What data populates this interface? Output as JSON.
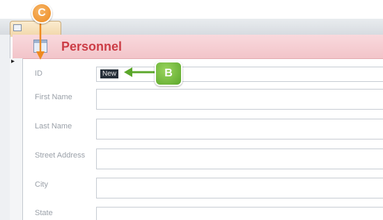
{
  "tab": {
    "label": ""
  },
  "form": {
    "title": "Personnel",
    "record_selector": "▸",
    "fields": [
      {
        "label": "ID",
        "value": "New"
      },
      {
        "label": "First Name",
        "value": ""
      },
      {
        "label": "Last Name",
        "value": ""
      },
      {
        "label": "Street Address",
        "value": ""
      },
      {
        "label": "City",
        "value": ""
      },
      {
        "label": "State",
        "value": ""
      }
    ]
  },
  "callouts": {
    "c": "C",
    "b": "B"
  },
  "colors": {
    "header_band": "#f2c4c9",
    "title_text": "#cc3d46",
    "callout_orange": "#ee8a1f",
    "callout_green": "#5ba72b"
  }
}
